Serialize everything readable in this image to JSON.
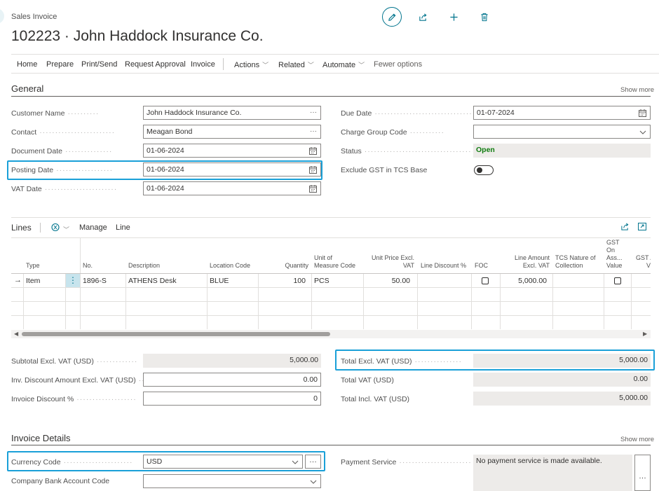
{
  "header": {
    "breadcrumb": "Sales Invoice",
    "title": "102223 · John Haddock Insurance Co."
  },
  "toolbar": {
    "edit_icon": "pencil-icon",
    "share_icon": "share-icon",
    "new_icon": "plus-icon",
    "delete_icon": "trash-icon"
  },
  "actionbar": {
    "home": "Home",
    "prepare": "Prepare",
    "print_send": "Print/Send",
    "request_approval": "Request Approval",
    "invoice": "Invoice",
    "actions": "Actions",
    "related": "Related",
    "automate": "Automate",
    "fewer_options": "Fewer options"
  },
  "general": {
    "title": "General",
    "show_more": "Show more",
    "customer_name_label": "Customer Name",
    "customer_name": "John Haddock Insurance Co.",
    "contact_label": "Contact",
    "contact": "Meagan Bond",
    "document_date_label": "Document Date",
    "document_date": "01-06-2024",
    "posting_date_label": "Posting Date",
    "posting_date": "01-06-2024",
    "vat_date_label": "VAT Date",
    "vat_date": "01-06-2024",
    "due_date_label": "Due Date",
    "due_date": "01-07-2024",
    "charge_group_label": "Charge Group Code",
    "charge_group": "",
    "status_label": "Status",
    "status": "Open",
    "exclude_gst_label": "Exclude GST in TCS Base"
  },
  "lines": {
    "title": "Lines",
    "manage": "Manage",
    "line": "Line",
    "columns": {
      "type": "Type",
      "no": "No.",
      "description": "Description",
      "location_code": "Location Code",
      "quantity": "Quantity",
      "uom_1": "Unit of",
      "uom_2": "Measure Code",
      "unit_price_1": "Unit Price Excl.",
      "unit_price_2": "VAT",
      "line_discount": "Line Discount %",
      "foc": "FOC",
      "line_amount_1": "Line Amount",
      "line_amount_2": "Excl. VAT",
      "tcs_1": "TCS Nature of",
      "tcs_2": "Collection",
      "gst_1": "GST",
      "gst_2": "On",
      "gst_3": "Ass...",
      "gst_4": "Value",
      "gst_a_1": "GST A",
      "gst_a_2": "V"
    },
    "row": {
      "type": "Item",
      "no": "1896-S",
      "description": "ATHENS Desk",
      "location_code": "BLUE",
      "quantity": "100",
      "uom": "PCS",
      "unit_price": "50.00",
      "line_amount": "5,000.00"
    }
  },
  "totals": {
    "subtotal_label": "Subtotal Excl. VAT (USD)",
    "subtotal": "5,000.00",
    "inv_discount_label": "Inv. Discount Amount Excl. VAT (USD)",
    "inv_discount": "0.00",
    "invoice_discount_pct_label": "Invoice Discount %",
    "invoice_discount_pct": "0",
    "total_excl_label": "Total Excl. VAT (USD)",
    "total_excl": "5,000.00",
    "total_vat_label": "Total VAT (USD)",
    "total_vat": "0.00",
    "total_incl_label": "Total Incl. VAT (USD)",
    "total_incl": "5,000.00"
  },
  "invoice_details": {
    "title": "Invoice Details",
    "show_more": "Show more",
    "currency_code_label": "Currency Code",
    "currency_code": "USD",
    "company_bank_label": "Company Bank Account Code",
    "company_bank": "",
    "payment_service_label": "Payment Service",
    "payment_service": "No payment service is made available."
  }
}
